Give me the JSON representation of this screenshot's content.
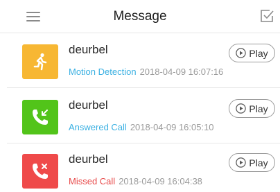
{
  "header": {
    "title": "Message"
  },
  "messages": [
    {
      "device": "deurbel",
      "event_type": "Motion Detection",
      "timestamp": "2018-04-09 16:07:16",
      "play_label": "Play",
      "icon": "running-person-icon",
      "icon_color": "#f7b733",
      "event_color": "#3ab0e2"
    },
    {
      "device": "deurbel",
      "event_type": "Answered Call",
      "timestamp": "2018-04-09 16:05:10",
      "play_label": "Play",
      "icon": "phone-incoming-icon",
      "icon_color": "#52c41a",
      "event_color": "#3ab0e2"
    },
    {
      "device": "deurbel",
      "event_type": "Missed Call",
      "timestamp": "2018-04-09 16:04:38",
      "play_label": "Play",
      "icon": "phone-missed-icon",
      "icon_color": "#ef4a4a",
      "event_color": "#e84a4a"
    }
  ]
}
